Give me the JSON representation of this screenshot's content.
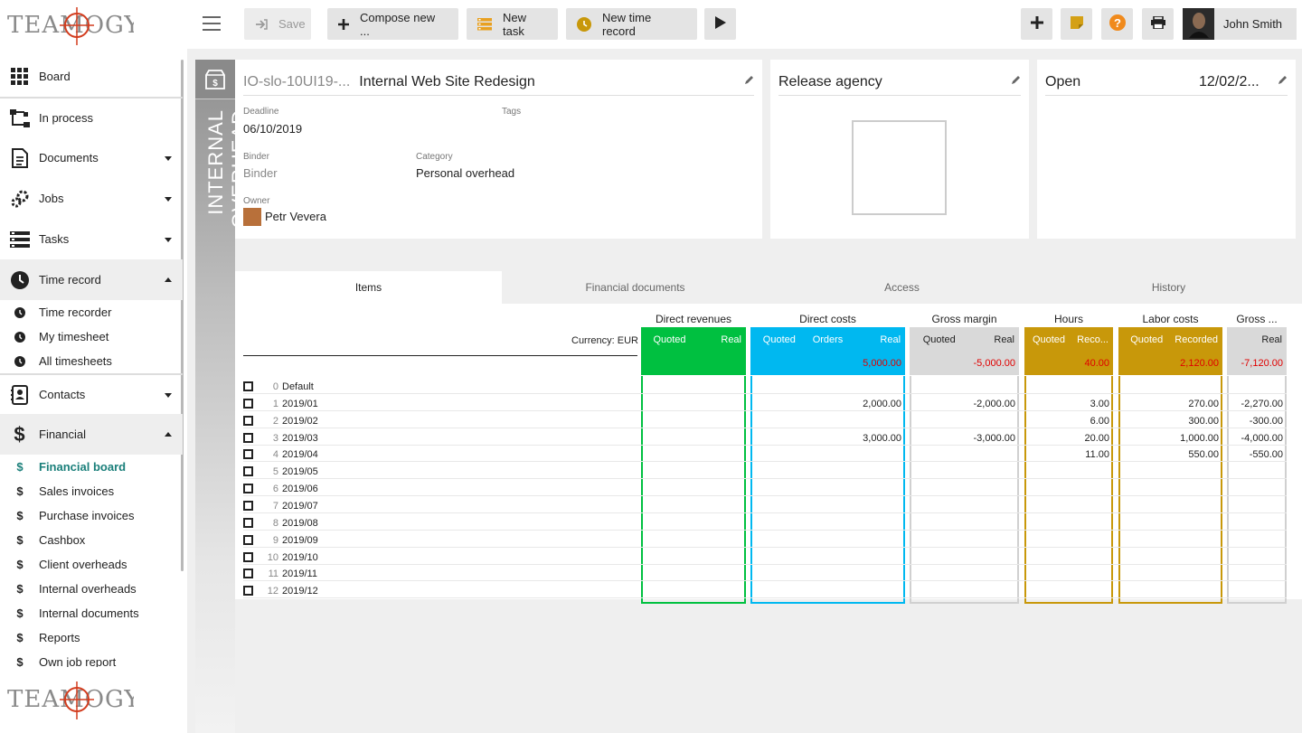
{
  "app": {
    "logo_text": "TEAMOGY"
  },
  "colors": {
    "green": "#00c040",
    "cyan": "#00b8f0",
    "grey": "#d9d9d9",
    "gold": "#c8980a",
    "red": "#e00000",
    "teal": "#1a7f7a"
  },
  "sidebar": {
    "items": [
      {
        "label": "Board",
        "icon": "grid-icon"
      },
      {
        "label": "In process",
        "icon": "flow-icon"
      },
      {
        "label": "Documents",
        "icon": "document-icon"
      },
      {
        "label": "Jobs",
        "icon": "gears-icon"
      },
      {
        "label": "Tasks",
        "icon": "tasks-icon"
      },
      {
        "label": "Time record",
        "icon": "clock-icon"
      },
      {
        "label": "Contacts",
        "icon": "contacts-icon"
      },
      {
        "label": "Financial",
        "icon": "dollar-icon"
      }
    ],
    "time_sub": [
      "Time recorder",
      "My timesheet",
      "All timesheets"
    ],
    "financial_sub": [
      "Financial board",
      "Sales invoices",
      "Purchase invoices",
      "Cashbox",
      "Client overheads",
      "Internal overheads",
      "Internal documents",
      "Reports",
      "Own job report"
    ]
  },
  "toolbar": {
    "save": "Save",
    "compose": "Compose new ...",
    "new_task": "New task",
    "new_time": "New time record",
    "user_name": "John Smith"
  },
  "band_label": "INTERNAL OVERHEAD",
  "card1": {
    "code": "IO-slo-10UI19-...",
    "title": "Internal Web Site Redesign",
    "deadline_label": "Deadline",
    "deadline": "06/10/2019",
    "tags_label": "Tags",
    "binder_label": "Binder",
    "binder": "Binder",
    "category_label": "Category",
    "category": "Personal overhead",
    "owner_label": "Owner",
    "owner": "Petr Vevera"
  },
  "card2": {
    "title": "Release agency"
  },
  "card3": {
    "status": "Open",
    "date": "12/02/2..."
  },
  "tabs": [
    "Items",
    "Financial documents",
    "Access",
    "History"
  ],
  "grid": {
    "currency": "Currency: EUR",
    "groups": [
      "Direct revenues",
      "Direct costs",
      "Gross margin",
      "Hours",
      "Labor costs",
      "Gross ..."
    ],
    "subheads": {
      "dr": [
        "Quoted",
        "Real"
      ],
      "dc": [
        "Quoted",
        "Orders",
        "Real"
      ],
      "gm": [
        "Quoted",
        "Real"
      ],
      "hr": [
        "Quoted",
        "Reco..."
      ],
      "lc": [
        "Quoted",
        "Recorded"
      ],
      "gr": [
        "Real"
      ]
    },
    "sums": {
      "dc_real": "5,000.00",
      "gm_real": "-5,000.00",
      "hr_rec": "40.00",
      "lc_rec": "2,120.00",
      "gr_real": "-7,120.00"
    },
    "rows": [
      {
        "n": "0",
        "label": "Default",
        "dc": "",
        "gm": "",
        "hr": "",
        "lc": "",
        "gr": ""
      },
      {
        "n": "1",
        "label": "2019/01",
        "dc": "2,000.00",
        "gm": "-2,000.00",
        "hr": "3.00",
        "lc": "270.00",
        "gr": "-2,270.00"
      },
      {
        "n": "2",
        "label": "2019/02",
        "dc": "",
        "gm": "",
        "hr": "6.00",
        "lc": "300.00",
        "gr": "-300.00"
      },
      {
        "n": "3",
        "label": "2019/03",
        "dc": "3,000.00",
        "gm": "-3,000.00",
        "hr": "20.00",
        "lc": "1,000.00",
        "gr": "-4,000.00"
      },
      {
        "n": "4",
        "label": "2019/04",
        "dc": "",
        "gm": "",
        "hr": "11.00",
        "lc": "550.00",
        "gr": "-550.00"
      },
      {
        "n": "5",
        "label": "2019/05",
        "dc": "",
        "gm": "",
        "hr": "",
        "lc": "",
        "gr": ""
      },
      {
        "n": "6",
        "label": "2019/06",
        "dc": "",
        "gm": "",
        "hr": "",
        "lc": "",
        "gr": ""
      },
      {
        "n": "7",
        "label": "2019/07",
        "dc": "",
        "gm": "",
        "hr": "",
        "lc": "",
        "gr": ""
      },
      {
        "n": "8",
        "label": "2019/08",
        "dc": "",
        "gm": "",
        "hr": "",
        "lc": "",
        "gr": ""
      },
      {
        "n": "9",
        "label": "2019/09",
        "dc": "",
        "gm": "",
        "hr": "",
        "lc": "",
        "gr": ""
      },
      {
        "n": "10",
        "label": "2019/10",
        "dc": "",
        "gm": "",
        "hr": "",
        "lc": "",
        "gr": ""
      },
      {
        "n": "11",
        "label": "2019/11",
        "dc": "",
        "gm": "",
        "hr": "",
        "lc": "",
        "gr": ""
      },
      {
        "n": "12",
        "label": "2019/12",
        "dc": "",
        "gm": "",
        "hr": "",
        "lc": "",
        "gr": ""
      }
    ]
  }
}
